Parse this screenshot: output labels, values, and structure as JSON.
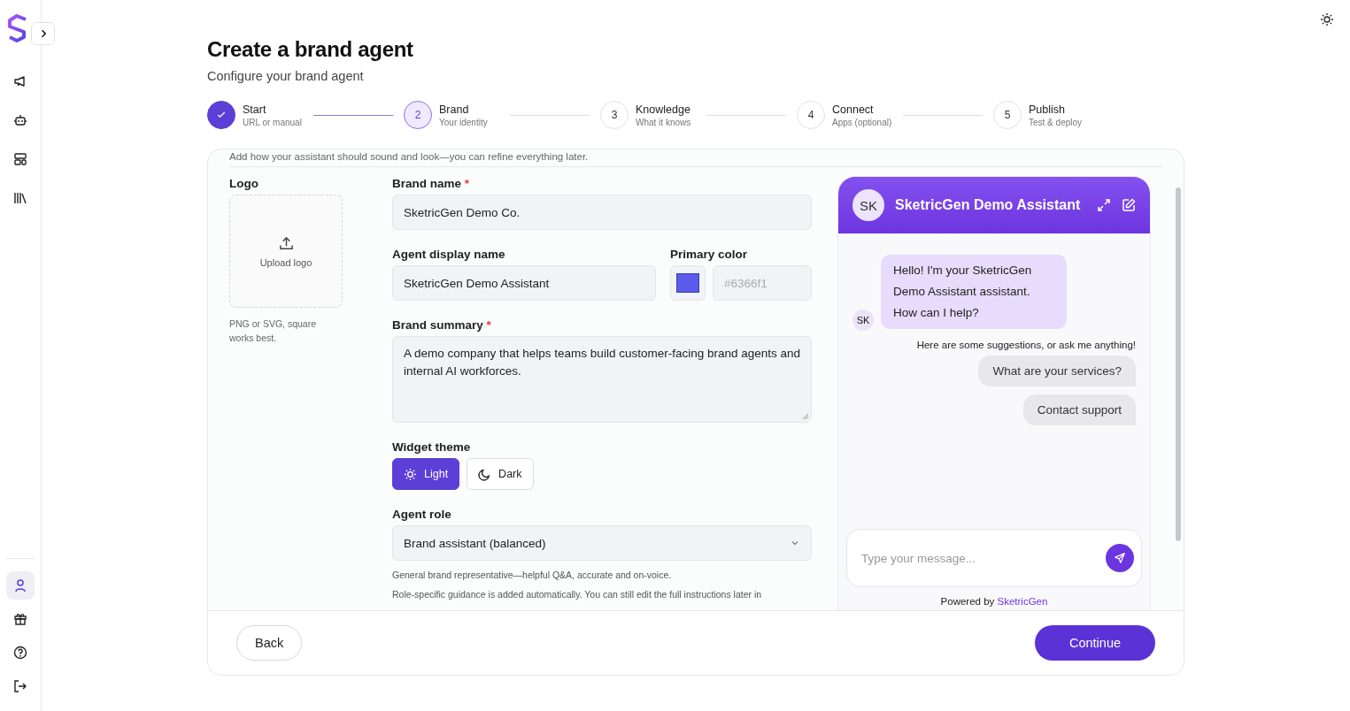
{
  "sidebar": {
    "nav": [
      {
        "selected": false
      },
      {
        "selected": false
      },
      {
        "selected": false
      },
      {
        "selected": false
      }
    ],
    "bottom": [
      {
        "selected": true
      },
      {
        "selected": false
      },
      {
        "selected": false
      },
      {
        "selected": false
      }
    ]
  },
  "title": "Create a brand agent",
  "subtitle": "Configure your brand agent",
  "steps": [
    {
      "title": "Start",
      "subtitle": "URL or manual",
      "completed": true,
      "selected": false
    },
    {
      "number": "2",
      "title": "Brand",
      "subtitle": "Your identity",
      "completed": false,
      "selected": true
    },
    {
      "number": "3",
      "title": "Knowledge",
      "subtitle": "What it knows",
      "completed": false,
      "selected": false
    },
    {
      "number": "4",
      "title": "Connect",
      "subtitle": "Apps (optional)",
      "completed": false,
      "selected": false
    },
    {
      "number": "5",
      "title": "Publish",
      "subtitle": "Test & deploy",
      "completed": false,
      "selected": false
    }
  ],
  "form": {
    "intro": "Add how your assistant should sound and look—you can refine everything later.",
    "logo": {
      "label": "Logo",
      "upload": "Upload logo",
      "hint": "PNG or SVG, square works best."
    },
    "brand_name": {
      "label": "Brand name",
      "required_mark": "*",
      "value": "SketricGen Demo Co."
    },
    "agent_display_name": {
      "label": "Agent display name",
      "value": "SketricGen Demo Assistant"
    },
    "primary_color": {
      "label": "Primary color",
      "color": "#5b5bea",
      "placeholder": "#6366f1"
    },
    "brand_summary": {
      "label": "Brand summary",
      "required_mark": "*",
      "value": "A demo company that helps teams build customer-facing brand agents and internal AI workforces."
    },
    "widget_theme": {
      "label": "Widget theme",
      "options": [
        {
          "label": "Light",
          "selected": true
        },
        {
          "label": "Dark",
          "selected": false
        }
      ]
    },
    "agent_role": {
      "label": "Agent role",
      "value": "Brand assistant (balanced)",
      "description": "General brand representative—helpful Q&A, accurate and on-voice.",
      "note": "Role-specific guidance is added automatically. You can still edit the full instructions later in"
    }
  },
  "chat_preview": {
    "avatar": "SK",
    "title": "SketricGen Demo Assistant",
    "messages": [
      {
        "avatar": "SK",
        "text": "Hello! I'm your SketricGen Demo Assistant assistant. How can I help?"
      }
    ],
    "suggestions_intro": "Here are some suggestions, or ask me anything!",
    "suggestions": [
      "What are your services?",
      "Contact support"
    ],
    "input_placeholder": "Type your message...",
    "powered_by": "Powered by",
    "powered_by_link": "SketricGen"
  },
  "footer": {
    "back": "Back",
    "continue": "Continue"
  }
}
